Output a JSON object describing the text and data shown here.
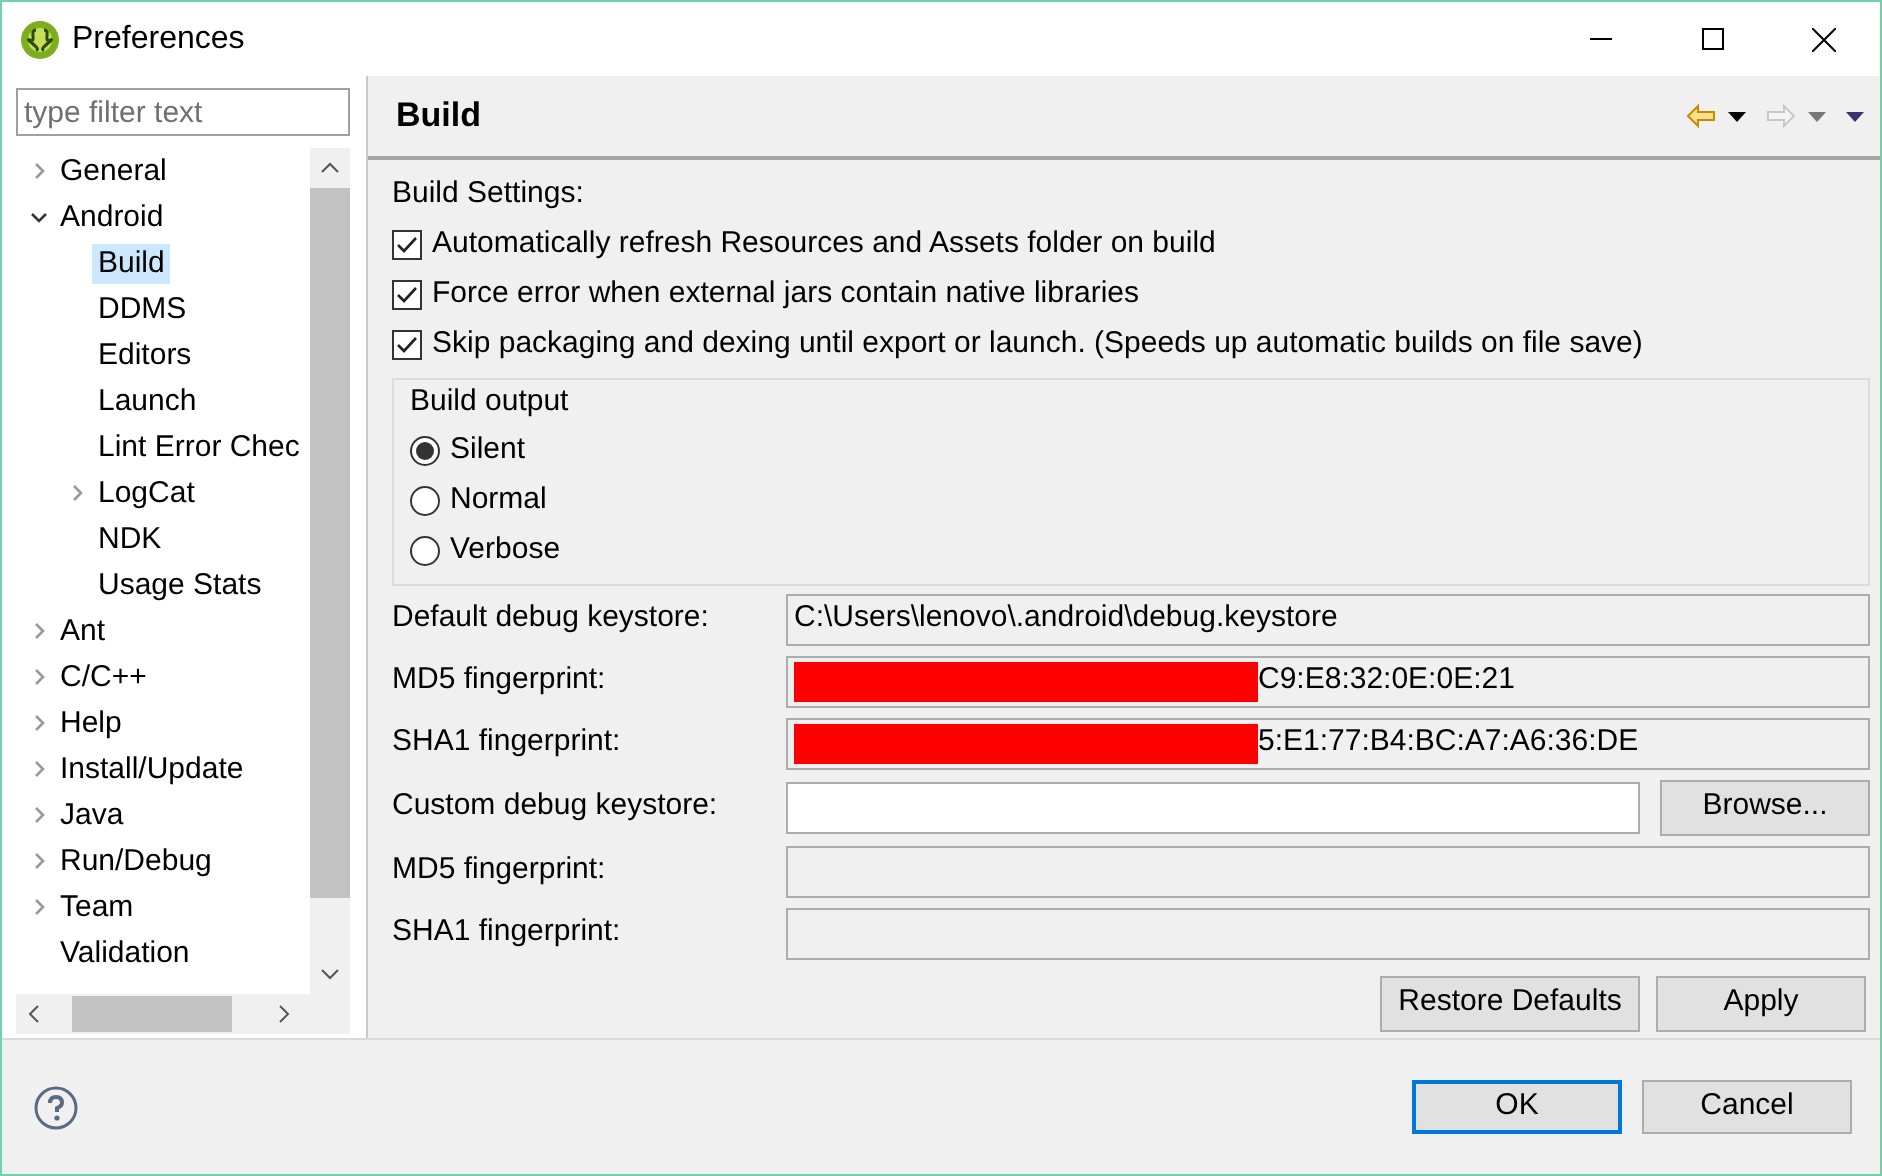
{
  "window": {
    "title": "Preferences"
  },
  "filter": {
    "placeholder": "type filter text"
  },
  "tree": [
    {
      "label": "General",
      "expanded": false,
      "selected": false
    },
    {
      "label": "Android",
      "expanded": true,
      "selected": false,
      "children": [
        {
          "label": "Build",
          "selected": true
        },
        {
          "label": "DDMS",
          "selected": false
        },
        {
          "label": "Editors",
          "selected": false
        },
        {
          "label": "Launch",
          "selected": false
        },
        {
          "label": "Lint Error Chec",
          "selected": false
        },
        {
          "label": "LogCat",
          "expanded": false,
          "selected": false
        },
        {
          "label": "NDK",
          "selected": false
        },
        {
          "label": "Usage Stats",
          "selected": false
        }
      ]
    },
    {
      "label": "Ant",
      "expanded": false,
      "selected": false
    },
    {
      "label": "C/C++",
      "expanded": false,
      "selected": false
    },
    {
      "label": "Help",
      "expanded": false,
      "selected": false
    },
    {
      "label": "Install/Update",
      "expanded": false,
      "selected": false
    },
    {
      "label": "Java",
      "expanded": false,
      "selected": false
    },
    {
      "label": "Run/Debug",
      "expanded": false,
      "selected": false
    },
    {
      "label": "Team",
      "expanded": false,
      "selected": false
    },
    {
      "label": "Validation",
      "selected": false
    }
  ],
  "page": {
    "title": "Build",
    "settings_label": "Build Settings:",
    "checkboxes": [
      {
        "label": "Automatically refresh Resources and Assets folder on build",
        "checked": true
      },
      {
        "label": "Force error when external jars contain native libraries",
        "checked": true
      },
      {
        "label": "Skip packaging and dexing until export or launch. (Speeds up automatic builds on file save)",
        "checked": true
      }
    ],
    "build_output": {
      "title": "Build output",
      "options": [
        {
          "label": "Silent",
          "selected": true
        },
        {
          "label": "Normal",
          "selected": false
        },
        {
          "label": "Verbose",
          "selected": false
        }
      ]
    },
    "fields": [
      {
        "label": "Default debug keystore:",
        "kind": "readonly",
        "value": "C:\\Users\\lenovo\\.android\\debug.keystore",
        "redacted": false
      },
      {
        "label": "MD5 fingerprint:",
        "kind": "readonly",
        "value": "C9:E8:32:0E:0E:21",
        "redacted": true
      },
      {
        "label": "SHA1 fingerprint:",
        "kind": "readonly",
        "value": "5:E1:77:B4:BC:A7:A6:36:DE",
        "redacted": true
      },
      {
        "label": "Custom debug keystore:",
        "kind": "input",
        "button": "Browse..."
      },
      {
        "label": "MD5 fingerprint:",
        "kind": "readonly",
        "redacted": false
      },
      {
        "label": "SHA1 fingerprint:",
        "kind": "readonly",
        "redacted": false
      }
    ],
    "buttons": [
      "Restore Defaults",
      "Apply"
    ]
  },
  "dialog_buttons": [
    {
      "label": "OK",
      "default": true
    },
    {
      "label": "Cancel",
      "default": false
    }
  ]
}
